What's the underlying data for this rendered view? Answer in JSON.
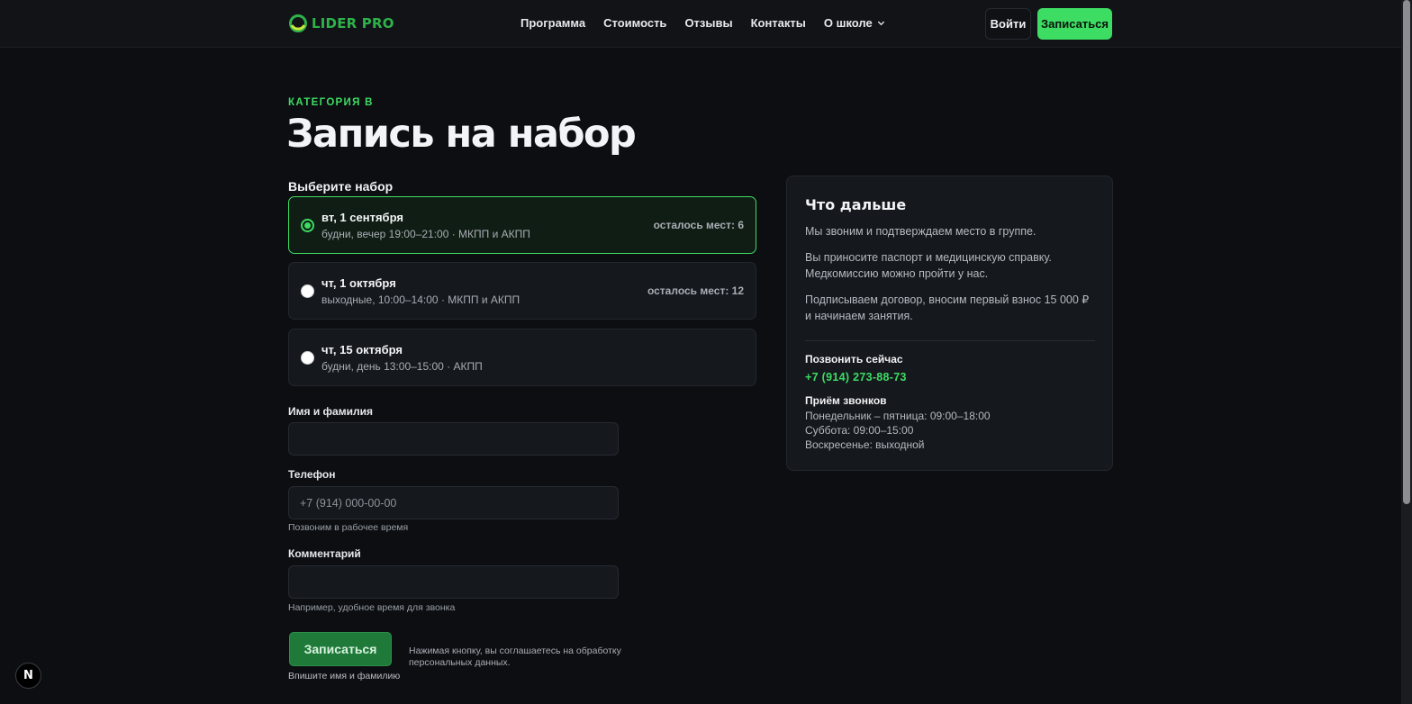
{
  "header": {
    "brand": "LIDER PRO",
    "nav": [
      {
        "label": "Программа"
      },
      {
        "label": "Стоимость"
      },
      {
        "label": "Отзывы"
      },
      {
        "label": "Контакты"
      },
      {
        "label": "О школе",
        "has_dropdown": true
      }
    ],
    "login_label": "Войти",
    "signup_label": "Записаться"
  },
  "page": {
    "eyebrow": "КАТЕГОРИЯ B",
    "title": "Запись на набор"
  },
  "form": {
    "choose_label": "Выберите набор",
    "slots": [
      {
        "date": "вт, 1 сентября",
        "desc": "будни, вечер 19:00–21:00 · МКПП и АКПП",
        "seats": "осталось мест: 6",
        "selected": true
      },
      {
        "date": "чт, 1 октября",
        "desc": "выходные, 10:00–14:00 · МКПП и АКПП",
        "seats": "осталось мест: 12",
        "selected": false
      },
      {
        "date": "чт, 15 октября",
        "desc": "будни, день 13:00–15:00 · АКПП",
        "seats": "",
        "selected": false
      }
    ],
    "name_label": "Имя и фамилия",
    "name_value": "",
    "phone_label": "Телефон",
    "phone_placeholder": "+7 (914) 000-00-00",
    "phone_hint": "Позвоним в рабочее время",
    "comment_label": "Комментарий",
    "comment_value": "",
    "comment_hint": "Например, удобное время для звонка",
    "submit_label": "Записаться",
    "consent": "Нажимая кнопку, вы соглашаетесь на обработку персональных данных.",
    "error": "Впишите имя и фамилию"
  },
  "sidebar": {
    "title": "Что дальше",
    "steps": [
      "Мы звоним и подтверждаем место в группе.",
      "Вы приносите паспорт и медицинскую справку. Медкомиссию можно пройти у нас.",
      "Подписываем договор, вносим первый взнос 15 000 ₽ и начинаем занятия."
    ],
    "call_label": "Позвонить сейчас",
    "phone": "+7 (914) 273-88-73",
    "hours_label": "Приём звонков",
    "hours": [
      "Понедельник – пятница: 09:00–18:00",
      "Суббота: 09:00–15:00",
      "Воскресенье: выходной"
    ]
  },
  "badge": {
    "letter": "N"
  },
  "colors": {
    "accent": "#3ddc63",
    "background": "#0c0e12",
    "card": "#15181d"
  }
}
